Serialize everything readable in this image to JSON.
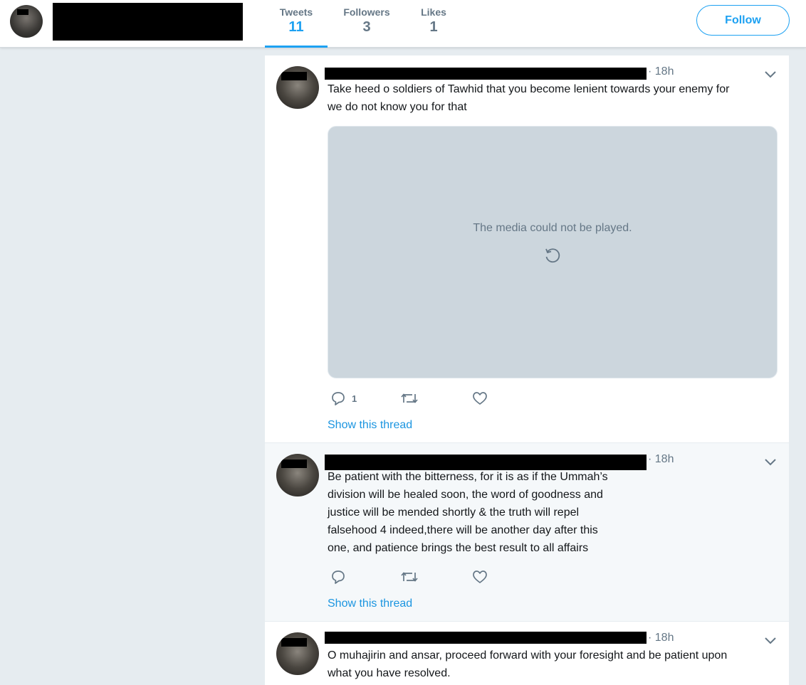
{
  "header": {
    "stats": [
      {
        "label": "Tweets",
        "value": "11"
      },
      {
        "label": "Followers",
        "value": "3"
      },
      {
        "label": "Likes",
        "value": "1"
      }
    ],
    "follow_label": "Follow"
  },
  "media": {
    "error_message": "The media could not be played."
  },
  "tweets": [
    {
      "time": "· 18h",
      "text": "Take heed o soldiers of Tawhid that you become lenient towards your enemy for\nwe do not know you for that",
      "reply_count": "1",
      "thread_link": "Show this thread"
    },
    {
      "time": "· 18h",
      "text": "Be patient with the bitterness, for it is as if the Ummah’s\ndivision will be healed soon, the word of goodness and\njustice will be mended shortly & the truth will repel\nfalsehood 4 indeed,there will be another day after this\none, and patience brings the best result to all affairs",
      "reply_count": "",
      "thread_link": "Show this thread"
    },
    {
      "time": "· 18h",
      "text": "O muhajirin and ansar, proceed forward with your foresight and be patient upon\nwhat you have resolved."
    }
  ],
  "colors": {
    "accent": "#1da1f2",
    "link": "#1b95e0",
    "muted": "#657786",
    "background": "#e6ecf0"
  }
}
